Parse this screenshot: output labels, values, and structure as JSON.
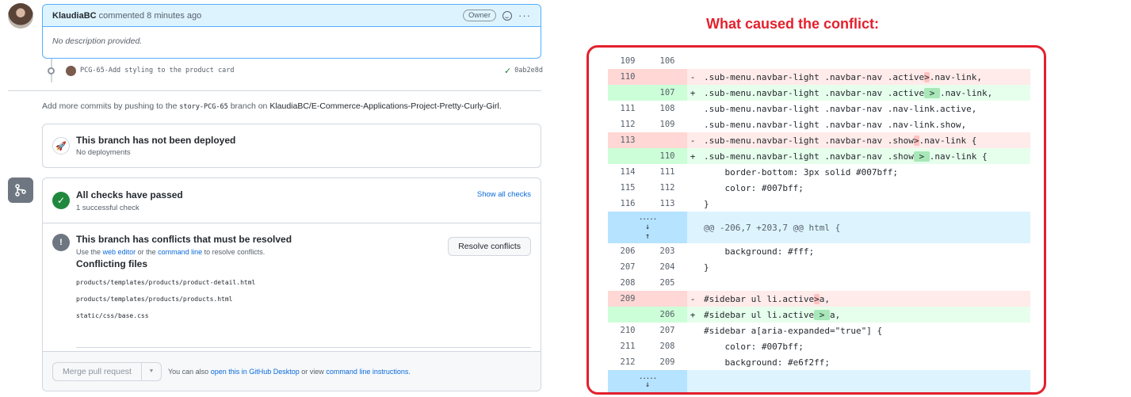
{
  "comment": {
    "author": "KlaudiaBC",
    "meta": "commented 8 minutes ago",
    "badge": "Owner",
    "body": "No description provided."
  },
  "commit": {
    "message": "PCG-65-Add styling to the product card",
    "sha": "0ab2e8d"
  },
  "add_commits": {
    "prefix": "Add more commits by pushing to the",
    "branch": "story-PCG-65",
    "middle": "branch on",
    "repo": "KlaudiaBC/E-Commerce-Applications-Project-Pretty-Curly-Girl."
  },
  "deploy": {
    "title": "This branch has not been deployed",
    "sub": "No deployments"
  },
  "checks": {
    "title": "All checks have passed",
    "sub": "1 successful check",
    "show_all": "Show all checks"
  },
  "conflicts": {
    "title": "This branch has conflicts that must be resolved",
    "use_the": "Use the",
    "web_editor": "web editor",
    "or_the": "or the",
    "command_line": "command line",
    "to_resolve": "to resolve conflicts.",
    "resolve_button": "Resolve conflicts",
    "files_title": "Conflicting files",
    "files": [
      "products/templates/products/product-detail.html",
      "products/templates/products/products.html",
      "static/css/base.css"
    ]
  },
  "merge": {
    "button": "Merge pull request",
    "also": "You can also",
    "desktop_link": "open this in GitHub Desktop",
    "or_view": "or view",
    "cli_link": "command line instructions."
  },
  "right": {
    "title": "What caused the conflict:",
    "hunk_header": "@@ -206,7 +203,7 @@ html {",
    "rows": [
      {
        "type": "ctx",
        "old": "109",
        "new": "106",
        "sign": "",
        "pre": "",
        "hl": "",
        "post": ""
      },
      {
        "type": "del",
        "old": "110",
        "new": "",
        "sign": "-",
        "pre": ".sub-menu.navbar-light .navbar-nav .active",
        "hl": ">",
        "post": ".nav-link,"
      },
      {
        "type": "add",
        "old": "",
        "new": "107",
        "sign": "+",
        "pre": ".sub-menu.navbar-light .navbar-nav .active",
        "hl": " > ",
        "post": ".nav-link,"
      },
      {
        "type": "ctx",
        "old": "111",
        "new": "108",
        "sign": "",
        "pre": ".sub-menu.navbar-light .navbar-nav .nav-link.active,",
        "hl": "",
        "post": ""
      },
      {
        "type": "ctx",
        "old": "112",
        "new": "109",
        "sign": "",
        "pre": ".sub-menu.navbar-light .navbar-nav .nav-link.show,",
        "hl": "",
        "post": ""
      },
      {
        "type": "del",
        "old": "113",
        "new": "",
        "sign": "-",
        "pre": ".sub-menu.navbar-light .navbar-nav .show",
        "hl": ">",
        "post": ".nav-link {"
      },
      {
        "type": "add",
        "old": "",
        "new": "110",
        "sign": "+",
        "pre": ".sub-menu.navbar-light .navbar-nav .show",
        "hl": " > ",
        "post": ".nav-link {"
      },
      {
        "type": "ctx",
        "old": "114",
        "new": "111",
        "sign": "",
        "pre": "    border-bottom: 3px solid #007bff;",
        "hl": "",
        "post": ""
      },
      {
        "type": "ctx",
        "old": "115",
        "new": "112",
        "sign": "",
        "pre": "    color: #007bff;",
        "hl": "",
        "post": ""
      },
      {
        "type": "ctx",
        "old": "116",
        "new": "113",
        "sign": "",
        "pre": "}",
        "hl": "",
        "post": ""
      },
      {
        "type": "hunk"
      },
      {
        "type": "ctx",
        "old": "206",
        "new": "203",
        "sign": "",
        "pre": "    background: #fff;",
        "hl": "",
        "post": ""
      },
      {
        "type": "ctx",
        "old": "207",
        "new": "204",
        "sign": "",
        "pre": "}",
        "hl": "",
        "post": ""
      },
      {
        "type": "ctx",
        "old": "208",
        "new": "205",
        "sign": "",
        "pre": "",
        "hl": "",
        "post": ""
      },
      {
        "type": "del",
        "old": "209",
        "new": "",
        "sign": "-",
        "pre": "#sidebar ul li.active",
        "hl": ">",
        "post": "a,"
      },
      {
        "type": "add",
        "old": "",
        "new": "206",
        "sign": "+",
        "pre": "#sidebar ul li.active",
        "hl": " > ",
        "post": "a,"
      },
      {
        "type": "ctx",
        "old": "210",
        "new": "207",
        "sign": "",
        "pre": "#sidebar a[aria-expanded=\"true\"] {",
        "hl": "",
        "post": ""
      },
      {
        "type": "ctx",
        "old": "211",
        "new": "208",
        "sign": "",
        "pre": "    color: #007bff;",
        "hl": "",
        "post": ""
      },
      {
        "type": "ctx",
        "old": "212",
        "new": "209",
        "sign": "",
        "pre": "    background: #e6f2ff;",
        "hl": "",
        "post": ""
      },
      {
        "type": "expand"
      }
    ]
  }
}
